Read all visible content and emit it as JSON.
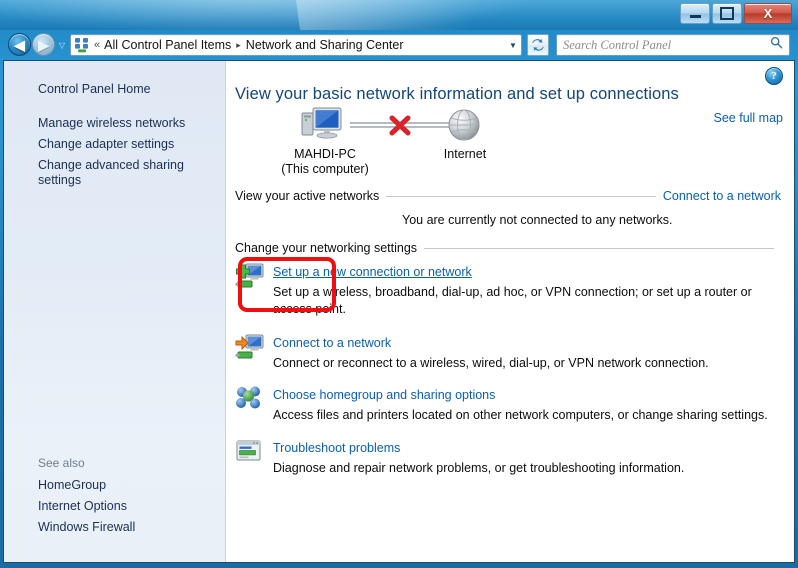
{
  "window": {
    "minimize_label": "Minimize",
    "maximize_label": "Maximize",
    "close_label": "X"
  },
  "nav": {
    "back_label": "◀",
    "forward_label": "▶",
    "history_label": "▽",
    "breadcrumb_icon": "network-sharing-icon",
    "breadcrumb_chevrons": "«",
    "breadcrumb": [
      "All Control Panel Items",
      "Network and Sharing Center"
    ],
    "breadcrumb_separator": "▸",
    "dropdown_label": "▼",
    "refresh_label": "refresh-icon",
    "search_placeholder": "Search Control Panel",
    "search_value": "",
    "search_icon": "magnifier-icon"
  },
  "sidebar": {
    "home_label": "Control Panel Home",
    "items": [
      {
        "label": "Manage wireless networks"
      },
      {
        "label": "Change adapter settings"
      },
      {
        "label": "Change advanced sharing settings"
      }
    ],
    "see_also_caption": "See also",
    "see_also": [
      {
        "label": "HomeGroup"
      },
      {
        "label": "Internet Options"
      },
      {
        "label": "Windows Firewall"
      }
    ]
  },
  "content": {
    "help_label": "?",
    "page_title": "View your basic network information and set up connections",
    "see_full_map": "See full map",
    "network_map": {
      "computer_name": "MAHDI-PC",
      "computer_sub": "(This computer)",
      "internet_label": "Internet",
      "connection_state": "disconnected",
      "x_marker_color": "#d9232a"
    },
    "active_networks": {
      "heading": "View your active networks",
      "action_link": "Connect to a network",
      "status_text": "You are currently not connected to any networks."
    },
    "change_settings": {
      "heading": "Change your networking settings"
    },
    "tasks": [
      {
        "icon": "new-connection-icon",
        "link": "Set up a new connection or network",
        "desc": "Set up a wireless, broadband, dial-up, ad hoc, or VPN connection; or set up a router or access point."
      },
      {
        "icon": "connect-network-icon",
        "link": "Connect to a network",
        "desc": "Connect or reconnect to a wireless, wired, dial-up, or VPN network connection."
      },
      {
        "icon": "homegroup-icon",
        "link": "Choose homegroup and sharing options",
        "desc": "Access files and printers located on other network computers, or change sharing settings."
      },
      {
        "icon": "troubleshoot-icon",
        "link": "Troubleshoot problems",
        "desc": "Diagnose and repair network problems, or get troubleshooting information."
      }
    ]
  },
  "annotation": {
    "shape": "red-rounded-rectangle",
    "color": "#ef0f0f"
  }
}
